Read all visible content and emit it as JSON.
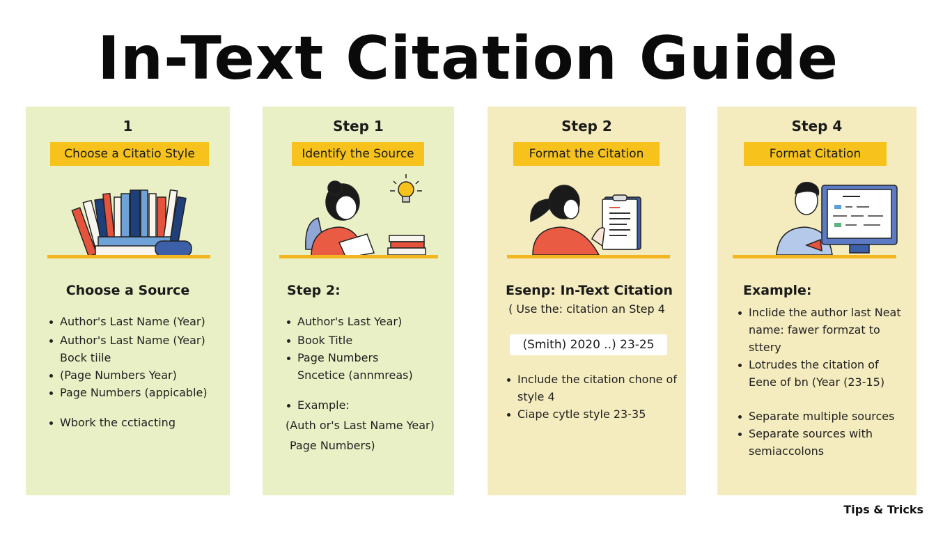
{
  "title": "In-Text Citation Guide",
  "colors": {
    "panel_green": "#eaf0c6",
    "panel_yellow": "#f4ecbe",
    "label_yellow": "#f7c21b",
    "shelf_orange": "#f3b61e"
  },
  "panels": [
    {
      "step": "1",
      "label": "Choose a Citatio Style",
      "illustration": "stack-of-books-icon",
      "heading": "Choose a Source",
      "bullets": [
        {
          "text": "Author's Last Name (Year)"
        },
        {
          "text": "Author's Last Name (Year)"
        },
        {
          "text": "Bock tiile",
          "continuation": true
        },
        {
          "text": "(Page Numbers Year)"
        },
        {
          "text": "Page Numbers (appicable)"
        },
        {
          "text": "Wbork the cctiacting"
        }
      ]
    },
    {
      "step": "Step 1",
      "label": "Identify the Source",
      "illustration": "woman-reading-with-lightbulb-icon",
      "heading": "Step 2:",
      "bullets": [
        {
          "text": "Author's Last Year)"
        },
        {
          "text": "Book Title"
        },
        {
          "text": "Page Numbers"
        },
        {
          "text": "Sncetice (annmreas)",
          "continuation": true
        },
        {
          "text": "Example:"
        },
        {
          "text": "(Auth or's Last Name Year)",
          "continuation": true
        },
        {
          "text": "Page Numbers)",
          "continuation": true
        }
      ]
    },
    {
      "step": "Step 2",
      "label": "Format the Citation",
      "illustration": "woman-with-clipboard-icon",
      "heading": "Esenp: In-Text Citation",
      "note": "( Use the: citation an Step 4",
      "citation_example": "(Smith) 2020 ..)  23-25",
      "bullets": [
        {
          "text": "Include the citation chone of"
        },
        {
          "text": "style 4",
          "continuation": true
        },
        {
          "text": "Ciape cytle style 23-35"
        }
      ]
    },
    {
      "step": "Step 4",
      "label": "Format Citation",
      "illustration": "man-at-computer-icon",
      "heading": "Example:",
      "bullets": [
        {
          "text": "Inclide the author last Neat"
        },
        {
          "text": "name: fawer formzat to",
          "continuation": true
        },
        {
          "text": "sttery",
          "continuation": true
        },
        {
          "text": "Lotrudes the citation of"
        },
        {
          "text": "Eene of bn (Year (23-15)",
          "continuation": true
        },
        {
          "text": "Separate multiple sources"
        },
        {
          "text": "Separate sources with"
        },
        {
          "text": "semiaccolons",
          "continuation": true
        }
      ]
    }
  ],
  "footer": "Tips & Tricks"
}
